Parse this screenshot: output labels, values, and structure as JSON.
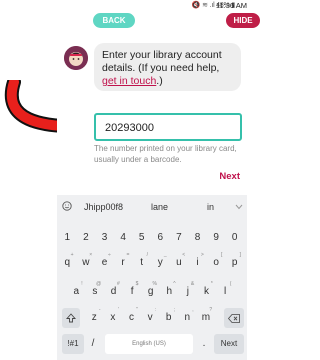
{
  "status": {
    "icons": "🔇 ≋ .ıl 48% ▮",
    "time": "11:36 AM"
  },
  "nav": {
    "back": "BACK",
    "hide": "HIDE"
  },
  "message": {
    "text_before": "Enter your library account details. (If you need help, ",
    "link": "get in touch",
    "text_after": ".)"
  },
  "card_input": {
    "value": "20293000"
  },
  "hint": "The number printed on your library card, usually under a barcode.",
  "next_label": "Next",
  "keyboard": {
    "suggestions": [
      "Jhipp00f8",
      "lane",
      "in"
    ],
    "row1": [
      "1",
      "2",
      "3",
      "4",
      "5",
      "6",
      "7",
      "8",
      "9",
      "0"
    ],
    "row2": [
      "q",
      "w",
      "e",
      "r",
      "t",
      "y",
      "u",
      "i",
      "o",
      "p"
    ],
    "row2_hints": [
      "+",
      "×",
      "÷",
      "=",
      "/",
      "_",
      "<",
      ">",
      "[",
      "]"
    ],
    "row3": [
      "a",
      "s",
      "d",
      "f",
      "g",
      "h",
      "j",
      "k",
      "l"
    ],
    "row3_hints": [
      "!",
      "@",
      "#",
      "$",
      "%",
      "^",
      "&",
      "*",
      "("
    ],
    "row4": [
      "z",
      "x",
      "c",
      "v",
      "b",
      "n",
      "m"
    ],
    "row4_hints": [
      "-",
      "'",
      "\"",
      ":",
      ";",
      ",",
      "?"
    ],
    "sym": "!#1",
    "slash": "/",
    "space": "English (US)",
    "period": ".",
    "enter": "Next"
  },
  "colors": {
    "accent": "#5fd6c3",
    "brand": "#bf1e47",
    "link": "#c0124c",
    "arrow": "#e8201c"
  }
}
